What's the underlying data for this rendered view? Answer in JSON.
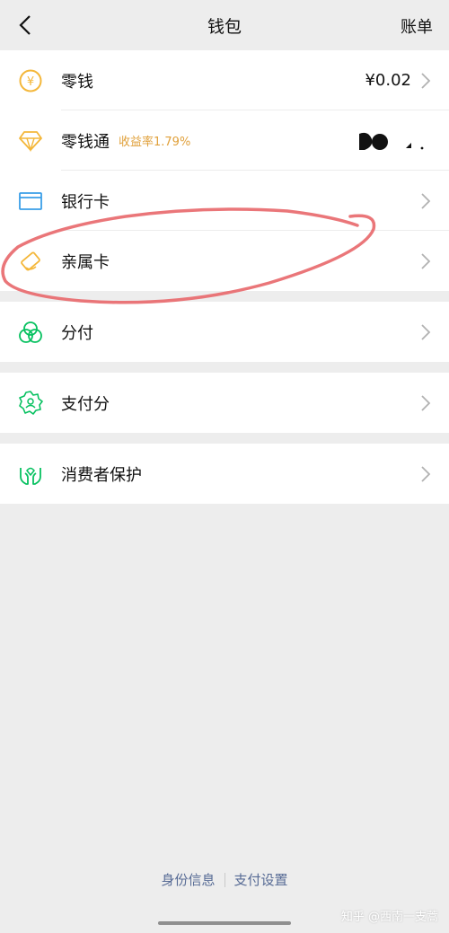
{
  "header": {
    "title": "钱包",
    "right_label": "账单"
  },
  "rows": [
    {
      "label": "零钱",
      "value": "¥0.02"
    },
    {
      "label": "零钱通",
      "sub": "收益率1.79%"
    },
    {
      "label": "银行卡"
    },
    {
      "label": "亲属卡"
    }
  ],
  "group2": {
    "label": "分付"
  },
  "group3": {
    "label": "支付分"
  },
  "group4": {
    "label": "消费者保护"
  },
  "footer": {
    "link1": "身份信息",
    "link2": "支付设置"
  },
  "watermark": "知乎 @西南一支蒿",
  "colors": {
    "accent_yellow": "#f4b73a",
    "accent_green": "#07c160",
    "accent_blue": "#3a9ee8",
    "link_blue": "#576b95",
    "annotation_red": "#e8676a"
  }
}
